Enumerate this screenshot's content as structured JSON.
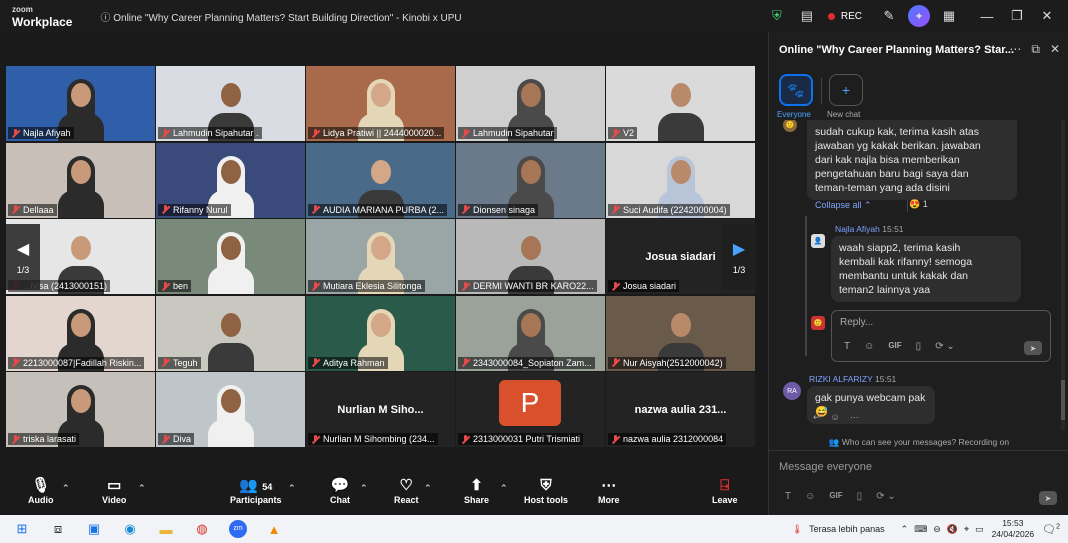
{
  "titlebar": {
    "brand_small": "zoom",
    "brand_large": "Workplace",
    "meeting_title": "Online \"Why Career Planning Matters? Start Building Direction\" - Kinobi x UPU",
    "rec_label": "REC",
    "icons": [
      "shield-icon",
      "notes-icon",
      "annotate-icon",
      "ai-companion-icon",
      "apps-icon",
      "minimize-icon",
      "restore-icon",
      "close-icon"
    ]
  },
  "gallery": {
    "page_left": "1/3",
    "page_right": "1/3",
    "tiles": [
      {
        "name": "Najla Afiyah",
        "kind": "video"
      },
      {
        "name": "Lahmudin Sipahutar .",
        "kind": "video"
      },
      {
        "name": "Lidya Pratiwi || 2444000020...",
        "kind": "video"
      },
      {
        "name": "Lahmudin Sipahutar",
        "kind": "video"
      },
      {
        "name": "V2",
        "kind": "video"
      },
      {
        "name": "Dellaaa",
        "kind": "video"
      },
      {
        "name": "Rifanny Nurul",
        "kind": "video"
      },
      {
        "name": "AUDIA MARIANA PURBA (2...",
        "kind": "video"
      },
      {
        "name": "Dionsen sinaga",
        "kind": "video"
      },
      {
        "name": "Suci Audifa (2242000004)",
        "kind": "video"
      },
      {
        "name": "...Nisa (2413000151)",
        "kind": "video"
      },
      {
        "name": "ben",
        "kind": "video"
      },
      {
        "name": "Mutiara Eklesia Silitonga",
        "kind": "video"
      },
      {
        "name": "DERMI WANTI BR KARO22...",
        "kind": "video"
      },
      {
        "name": "Josua siadari",
        "kind": "name",
        "center": "Josua siadari"
      },
      {
        "name": "2213000087|Fadillah Riskin...",
        "kind": "video"
      },
      {
        "name": "Teguh",
        "kind": "video"
      },
      {
        "name": "Aditya Rahman",
        "kind": "video"
      },
      {
        "name": "2343000084_Sopiaton Zam...",
        "kind": "video"
      },
      {
        "name": "Nur Aisyah(2512000042)",
        "kind": "video"
      },
      {
        "name": "triska larasati",
        "kind": "video"
      },
      {
        "name": "Diva",
        "kind": "video"
      },
      {
        "name": "Nurlian M Sihombing (234...",
        "kind": "name",
        "center": "Nurlian M Siho..."
      },
      {
        "name": "2313000031 Putri Trismiati",
        "kind": "avatar",
        "letter": "P"
      },
      {
        "name": "nazwa aulia 2312000084",
        "kind": "name",
        "center": "nazwa aulia 231..."
      }
    ]
  },
  "toolbar": {
    "audio": "Audio",
    "video": "Video",
    "participants": "Participants",
    "participants_count": "54",
    "chat": "Chat",
    "react": "React",
    "share": "Share",
    "host_tools": "Host tools",
    "more": "More",
    "leave": "Leave"
  },
  "chat": {
    "header": "Online \"Why Career Planning Matters? Star...",
    "tab_everyone": "Everyone",
    "tab_new": "New chat",
    "msg1": [
      "sudah cukup kak, terima kasih atas",
      "jawaban yg kakak berikan. jawaban",
      "dari kak najla bisa memberikan",
      "pengetahuan baru bagi saya dan",
      "teman-teman yang ada disini"
    ],
    "collapse_all": "Collapse all",
    "reaction": "😍 1",
    "reply_sender": "Najla Afiyah",
    "reply_time": "15:51",
    "reply_msg": [
      "waah siapp2, terima kasih",
      "kembali kak rifanny! semoga",
      "membantu untuk kakak dan",
      "teman2 lainnya yaa"
    ],
    "reply_placeholder": "Reply...",
    "sender2": "RIZKI ALFARIZY",
    "sender2_time": "15:51",
    "sender2_initials": "RA",
    "msg2": "gak punya webcam pak😅",
    "notice": "Who can see your messages? Recording on",
    "input_placeholder": "Message everyone"
  },
  "taskbar": {
    "weather": "Terasa lebih panas",
    "time": "15:53",
    "date": "24/04/2026",
    "notif_count": "2"
  },
  "colors": {
    "accent": "#0e72ed",
    "active_speaker": "#3ecf6e",
    "rec": "#e02e2e",
    "leave": "#e02e2e"
  }
}
